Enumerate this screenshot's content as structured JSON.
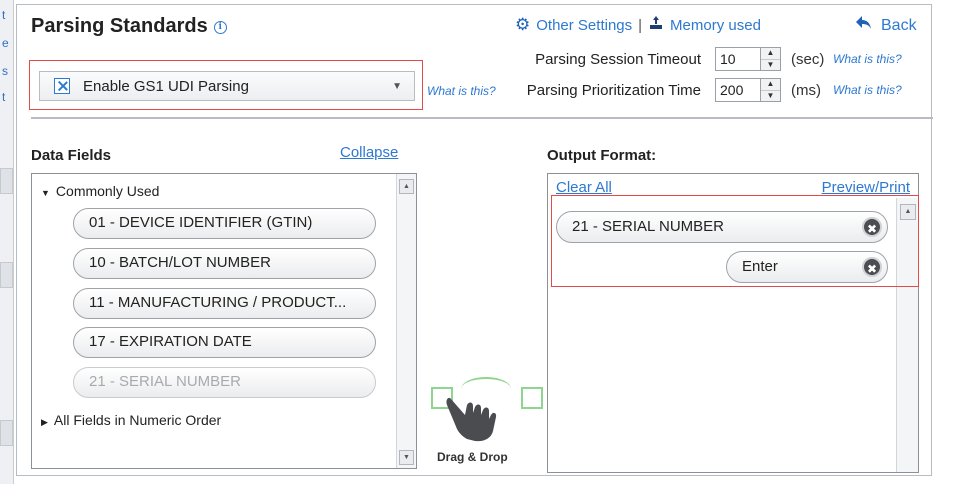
{
  "left_strip": {
    "fragments": [
      "t",
      "e",
      "s",
      "t"
    ]
  },
  "header": {
    "title": "Parsing Standards",
    "info_glyph": "i",
    "other_settings": "Other Settings",
    "separator": "|",
    "memory_used": "Memory used",
    "back": "Back"
  },
  "settings": {
    "timeout": {
      "label": "Parsing Session Timeout",
      "value": "10",
      "unit": "(sec)",
      "help": "What is this?"
    },
    "prioritization": {
      "label": "Parsing Prioritization Time",
      "value": "200",
      "unit": "(ms)",
      "help": "What is this?"
    }
  },
  "enable": {
    "label": "Enable GS1 UDI Parsing",
    "checked": true,
    "help": "What is this?"
  },
  "data_fields": {
    "title": "Data Fields",
    "collapse": "Collapse",
    "group_common": "Commonly Used",
    "items": [
      {
        "label": "01 - DEVICE IDENTIFIER (GTIN)",
        "disabled": false
      },
      {
        "label": "10 - BATCH/LOT NUMBER",
        "disabled": false
      },
      {
        "label": "11 - MANUFACTURING / PRODUCT...",
        "disabled": false
      },
      {
        "label": "17 - EXPIRATION DATE",
        "disabled": false
      },
      {
        "label": "21 - SERIAL NUMBER",
        "disabled": true
      }
    ],
    "group_all": "All Fields in Numeric Order"
  },
  "drag_drop": {
    "label": "Drag & Drop"
  },
  "output": {
    "title": "Output Format:",
    "clear_all": "Clear All",
    "preview_print": "Preview/Print",
    "items": [
      {
        "label": "21 -   SERIAL NUMBER",
        "remove": "✖"
      },
      {
        "label": "Enter",
        "remove": "✖"
      }
    ]
  },
  "icons": {
    "info": "info-icon",
    "gear": "gear-icon",
    "memory": "memory-icon",
    "back": "back-arrow-icon",
    "checkbox": "checkbox-icon",
    "dropdown": "chevron-down-icon",
    "hand": "hand-drag-icon",
    "remove": "remove-icon"
  },
  "colors": {
    "link": "#2d79d1",
    "highlight_border": "#e34b4b",
    "drag_hint": "#8fd48f"
  }
}
